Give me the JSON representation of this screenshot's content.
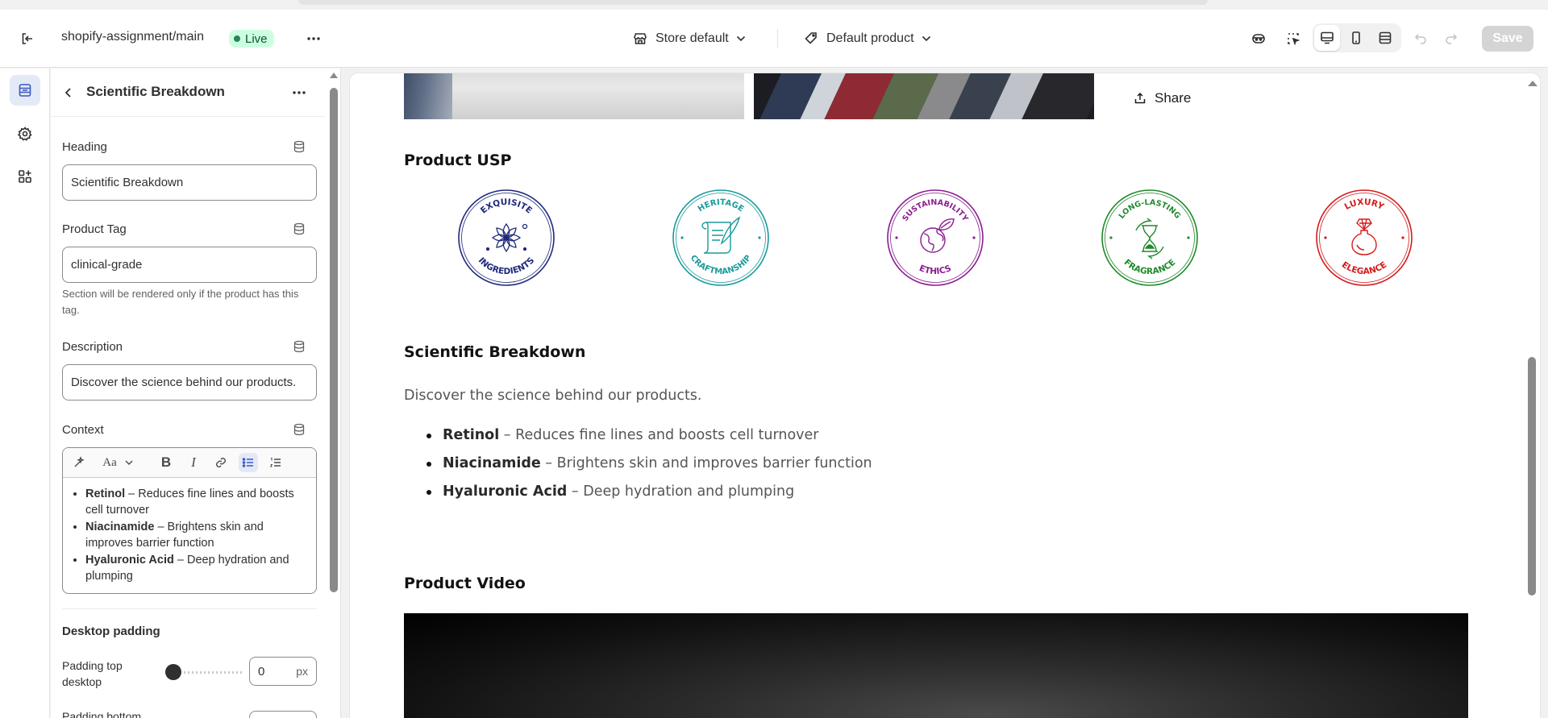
{
  "topbar": {
    "store_name": "shopify-assignment/main",
    "status_badge": "Live",
    "theme_selector": "Store default",
    "template_selector": "Default product",
    "save_label": "Save"
  },
  "panel": {
    "title": "Scientific Breakdown",
    "heading": {
      "label": "Heading",
      "value": "Scientific Breakdown"
    },
    "product_tag": {
      "label": "Product Tag",
      "value": "clinical-grade",
      "help": "Section will be rendered only if the product has this tag."
    },
    "description": {
      "label": "Description",
      "value": "Discover the science behind our products."
    },
    "context": {
      "label": "Context",
      "items": [
        {
          "term": "Retinol",
          "text": " – Reduces fine lines and boosts cell turnover"
        },
        {
          "term": "Niacinamide",
          "text": " – Brightens skin and improves barrier function"
        },
        {
          "term": "Hyaluronic Acid",
          "text": " – Deep hydration and plumping"
        }
      ]
    },
    "desktop_padding": {
      "title": "Desktop padding",
      "padding_top_label": "Padding top desktop",
      "padding_top_value": "0",
      "padding_unit": "px",
      "padding_bottom_label": "Padding bottom"
    }
  },
  "preview": {
    "share_label": "Share",
    "usp_heading": "Product USP",
    "usp_badges": [
      {
        "top": "EXQUISITE",
        "bottom": "INGREDIENTS",
        "color": "#1f2a7a",
        "icon": "flower-icon"
      },
      {
        "top": "HERITAGE",
        "bottom": "CRAFTMANSHIP",
        "color": "#1a9a9a",
        "icon": "scroll-quill-icon"
      },
      {
        "top": "SUSTAINABILITY",
        "bottom": "ETHICS",
        "color": "#8b1d8f",
        "icon": "globe-leaf-icon"
      },
      {
        "top": "LONG-LASTING",
        "bottom": "FRAGRANCE",
        "color": "#1e8a2a",
        "icon": "hourglass-icon"
      },
      {
        "top": "LUXURY",
        "bottom": "ELEGANCE",
        "color": "#d41c1c",
        "icon": "perfume-bottle-icon"
      }
    ],
    "sci_heading": "Scientific Breakdown",
    "sci_description": "Discover the science behind our products.",
    "sci_items": [
      {
        "term": "Retinol",
        "text": " – Reduces fine lines and boosts cell turnover"
      },
      {
        "term": "Niacinamide",
        "text": " – Brightens skin and improves barrier function"
      },
      {
        "term": "Hyaluronic Acid",
        "text": " – Deep hydration and plumping"
      }
    ],
    "video_heading": "Product Video"
  }
}
